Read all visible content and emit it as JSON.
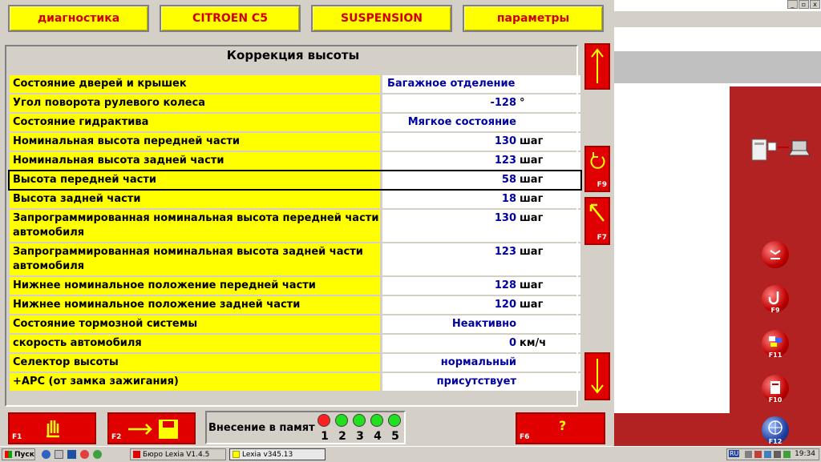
{
  "window_controls": {
    "minimize": "_",
    "restore": "▫",
    "close": "x"
  },
  "nav": [
    "диагностика",
    "CITROEN C5",
    "SUSPENSION",
    "параметры"
  ],
  "panel": {
    "title": "Коррекция высоты",
    "rows": [
      {
        "label": "Состояние дверей и крышек",
        "text": "Багажное отделение",
        "align": "left"
      },
      {
        "label": "Угол поворота рулевого колеса",
        "num": "-128",
        "unit": "°"
      },
      {
        "label": "Состояние гидрактива",
        "text": "Мягкое состояние"
      },
      {
        "label": "Номинальная высота передней части",
        "num": "130",
        "unit": "шаг"
      },
      {
        "label": "Номинальная высота задней части",
        "num": "123",
        "unit": "шаг"
      },
      {
        "label": "Высота передней части",
        "num": "58",
        "unit": "шаг",
        "selected": true
      },
      {
        "label": "Высота задней части",
        "num": "18",
        "unit": "шаг"
      },
      {
        "label": "Запрограммированная номинальная высота передней части автомобиля",
        "num": "130",
        "unit": "шаг"
      },
      {
        "label": "Запрограммированная номинальная высота задней части автомобиля",
        "num": "123",
        "unit": "шаг"
      },
      {
        "label": "Нижнее номинальное положение передней части",
        "num": "128",
        "unit": "шаг"
      },
      {
        "label": "Нижнее номинальное положение задней части",
        "num": "120",
        "unit": "шаг"
      },
      {
        "label": "Состояние тормозной системы",
        "text": "Неактивно"
      },
      {
        "label": "скорость автомобиля",
        "num": "0",
        "unit": "км/ч"
      },
      {
        "label": "Селектор высоты",
        "text": "нормальный"
      },
      {
        "label": "+APC (от замка зажигания)",
        "text": "присутствует"
      }
    ]
  },
  "side_keys": {
    "undo": "F9",
    "back": "F7"
  },
  "bottom": {
    "f1": "F1",
    "f2": "F2",
    "f6": "F6",
    "help": "?",
    "memory_label": "Внесение в памят",
    "leds": [
      "1",
      "2",
      "3",
      "4",
      "5"
    ]
  },
  "right_keys": {
    "f9": "F9",
    "f11": "F11",
    "f10": "F10",
    "f12": "F12"
  },
  "taskbar": {
    "start": "Пуск",
    "tasks": [
      "Бюро Lexia V1.4.5",
      "Lexia v345.13"
    ],
    "lang": "RU",
    "clock": "19:34"
  },
  "colors": {
    "label_bg": "#ffff00",
    "value_text": "#0000a0",
    "button_red": "#e00000",
    "nav_text": "#d00000",
    "led_red": "#ff2020",
    "led_green": "#20e020"
  }
}
